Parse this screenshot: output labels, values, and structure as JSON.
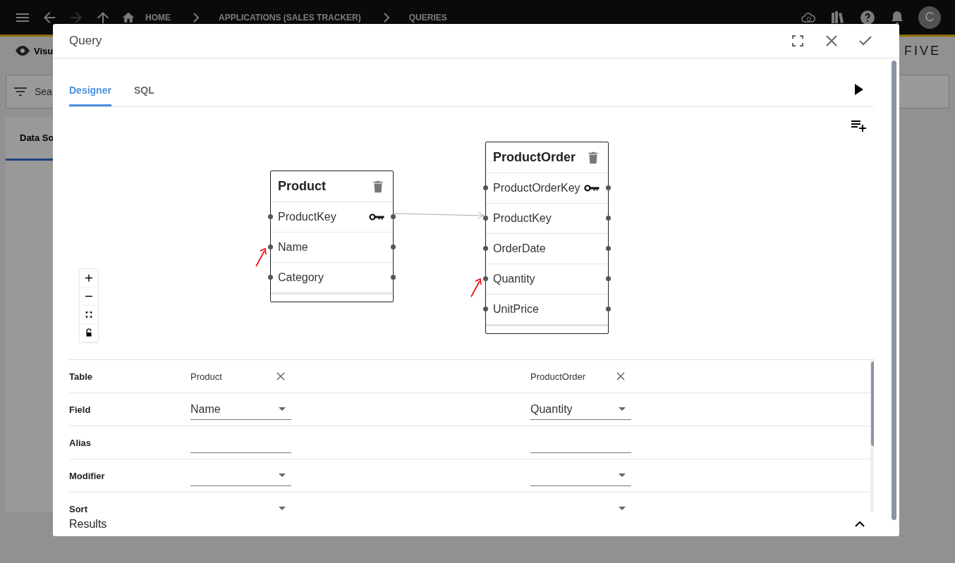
{
  "topbar": {
    "breadcrumbs": [
      "HOME",
      "APPLICATIONS (SALES TRACKER)",
      "QUERIES"
    ],
    "avatar": "C"
  },
  "background": {
    "view_label": "Visu",
    "search_placeholder": "Sea",
    "tab": "Data So",
    "logo": "FIVE"
  },
  "dialog": {
    "title": "Query",
    "tabs": [
      {
        "label": "Designer",
        "selected": true
      },
      {
        "label": "SQL",
        "selected": false
      }
    ],
    "tables": [
      {
        "name": "Product",
        "fields": [
          {
            "name": "ProductKey",
            "key": true
          },
          {
            "name": "Name",
            "key": false
          },
          {
            "name": "Category",
            "key": false
          }
        ]
      },
      {
        "name": "ProductOrder",
        "fields": [
          {
            "name": "ProductOrderKey",
            "key": true
          },
          {
            "name": "ProductKey",
            "key": false
          },
          {
            "name": "OrderDate",
            "key": false
          },
          {
            "name": "Quantity",
            "key": false
          },
          {
            "name": "UnitPrice",
            "key": false
          }
        ]
      }
    ],
    "grid": {
      "rows": [
        {
          "label": "Table",
          "kind": "table"
        },
        {
          "label": "Field",
          "kind": "field"
        },
        {
          "label": "Alias",
          "kind": "input"
        },
        {
          "label": "Modifier",
          "kind": "select"
        },
        {
          "label": "Sort",
          "kind": "select"
        }
      ],
      "columns": [
        {
          "table": "Product",
          "field": "Name"
        },
        {
          "table": "ProductOrder",
          "field": "Quantity"
        }
      ]
    },
    "results": "Results"
  }
}
